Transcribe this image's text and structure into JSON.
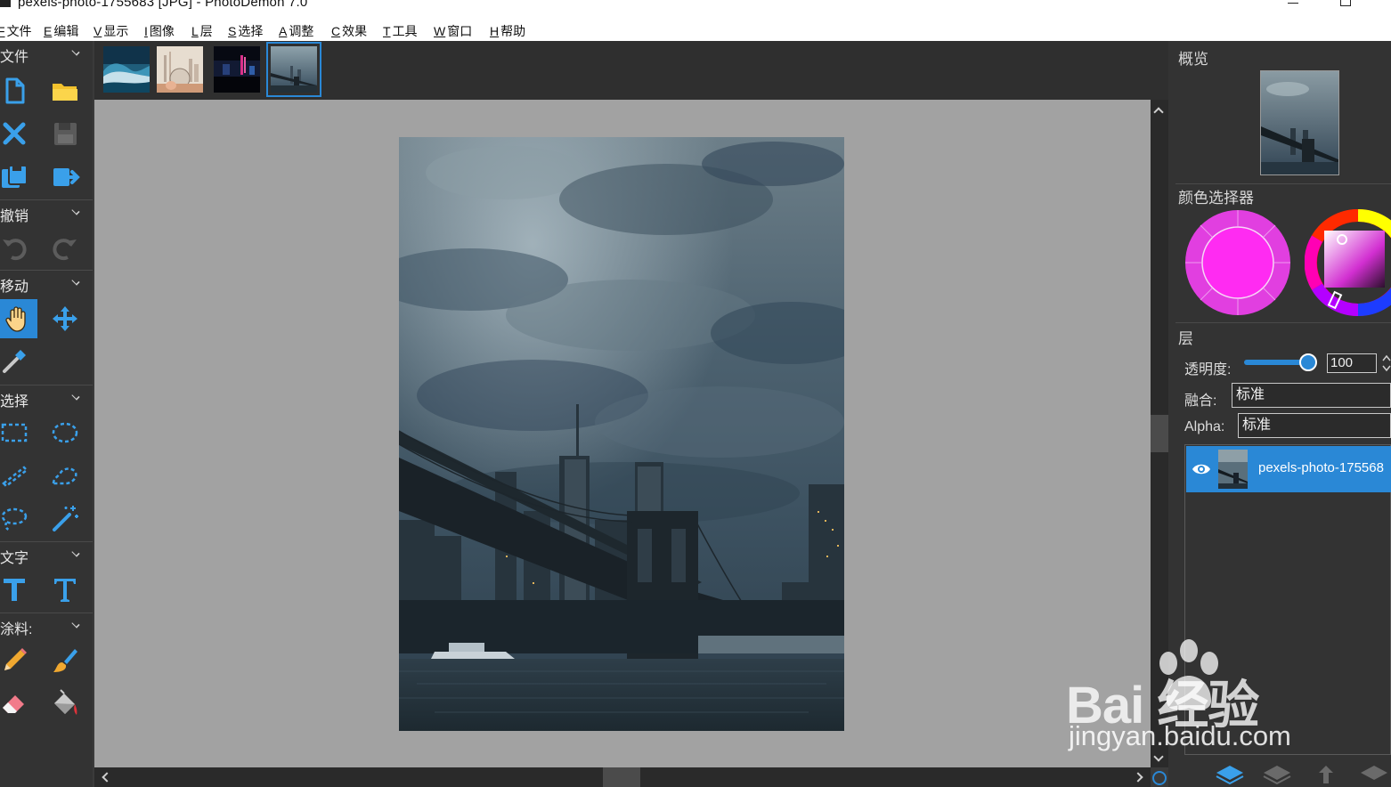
{
  "window": {
    "title": "pexels-photo-1755683 [JPG]  -  PhotoDemon 7.0"
  },
  "menu": [
    {
      "key": "F",
      "label": "文件"
    },
    {
      "key": "E",
      "label": "编辑"
    },
    {
      "key": "V",
      "label": "显示"
    },
    {
      "key": "I",
      "label": "图像"
    },
    {
      "key": "L",
      "label": "层"
    },
    {
      "key": "S",
      "label": "选择"
    },
    {
      "key": "A",
      "label": "调整"
    },
    {
      "key": "C",
      "label": "效果"
    },
    {
      "key": "T",
      "label": "工具"
    },
    {
      "key": "W",
      "label": "窗口"
    },
    {
      "key": "H",
      "label": "帮助"
    }
  ],
  "toolbox": {
    "sections": [
      "文件",
      "撤销",
      "移动",
      "选择",
      "文字",
      "涂料:"
    ],
    "active_tool": "hand-tool"
  },
  "thumbnails": [
    {
      "name": "wave-image-thumb"
    },
    {
      "name": "city-glass-ball-thumb"
    },
    {
      "name": "neon-city-thumb"
    },
    {
      "name": "bridge-photo-thumb",
      "selected": true
    }
  ],
  "right_panel": {
    "overview_title": "概览",
    "color_picker_title": "颜色选择器",
    "layers_title": "层",
    "opacity_label": "透明度:",
    "opacity_value": "100",
    "blend_label": "融合:",
    "blend_value": "标准",
    "alpha_label": "Alpha:",
    "alpha_value": "标准",
    "layer_name": "pexels-photo-175568",
    "current_color": "#ff2bf2"
  },
  "watermark": {
    "brand": "Bai  经验",
    "url": "jingyan.baidu.com"
  },
  "colors": {
    "accent": "#2a88d6",
    "panel_bg": "#333333",
    "canvas_bg": "#a2a2a2"
  }
}
